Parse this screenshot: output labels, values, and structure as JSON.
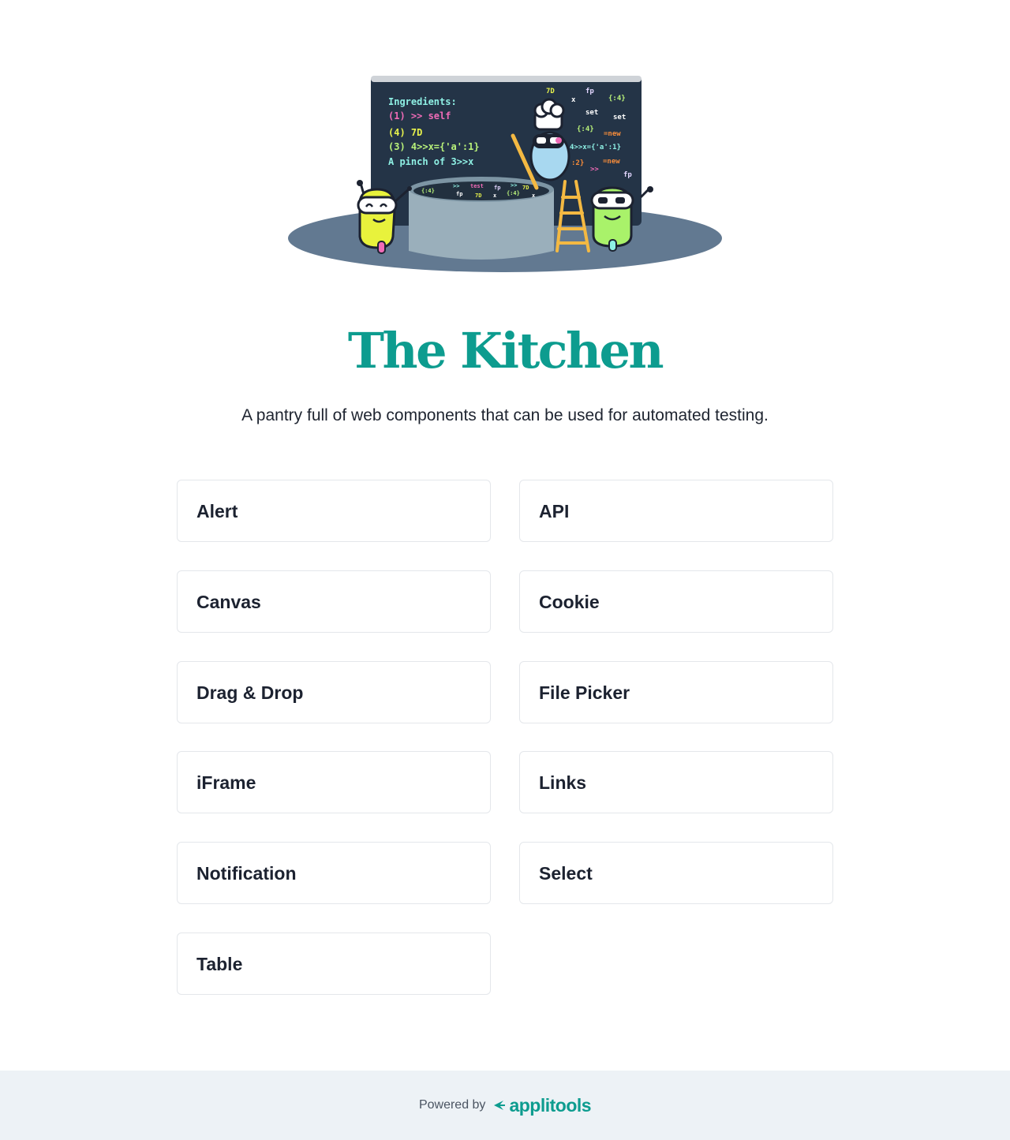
{
  "header": {
    "title": "The Kitchen",
    "subtitle": "A pantry full of web components that can be used for automated testing."
  },
  "illustration": {
    "board_lines": [
      "Ingredients:",
      "(1) >> self",
      "(4) 7D",
      "(3) 4>>x={'a':1}",
      "A pinch of 3>>x"
    ],
    "scatter": [
      "7D",
      "fp",
      "x",
      "{:4}",
      "set",
      "set",
      "{:4}",
      "=new",
      "4>>x={'a':1}",
      ":2}",
      "=new",
      ">>",
      "fp"
    ],
    "pot_text": [
      "{:4}",
      ">>",
      "test",
      "fp",
      ">>",
      "7D",
      "fp",
      "7D",
      "x",
      "{:4}",
      "x"
    ]
  },
  "components": [
    {
      "label": "Alert"
    },
    {
      "label": "API"
    },
    {
      "label": "Canvas"
    },
    {
      "label": "Cookie"
    },
    {
      "label": "Drag & Drop"
    },
    {
      "label": "File Picker"
    },
    {
      "label": "iFrame"
    },
    {
      "label": "Links"
    },
    {
      "label": "Notification"
    },
    {
      "label": "Select"
    },
    {
      "label": "Table"
    }
  ],
  "footer": {
    "powered_by": "Powered by",
    "brand": "applitools"
  },
  "colors": {
    "accent": "#0d9c8f",
    "footer_bg": "#edf2f6"
  }
}
